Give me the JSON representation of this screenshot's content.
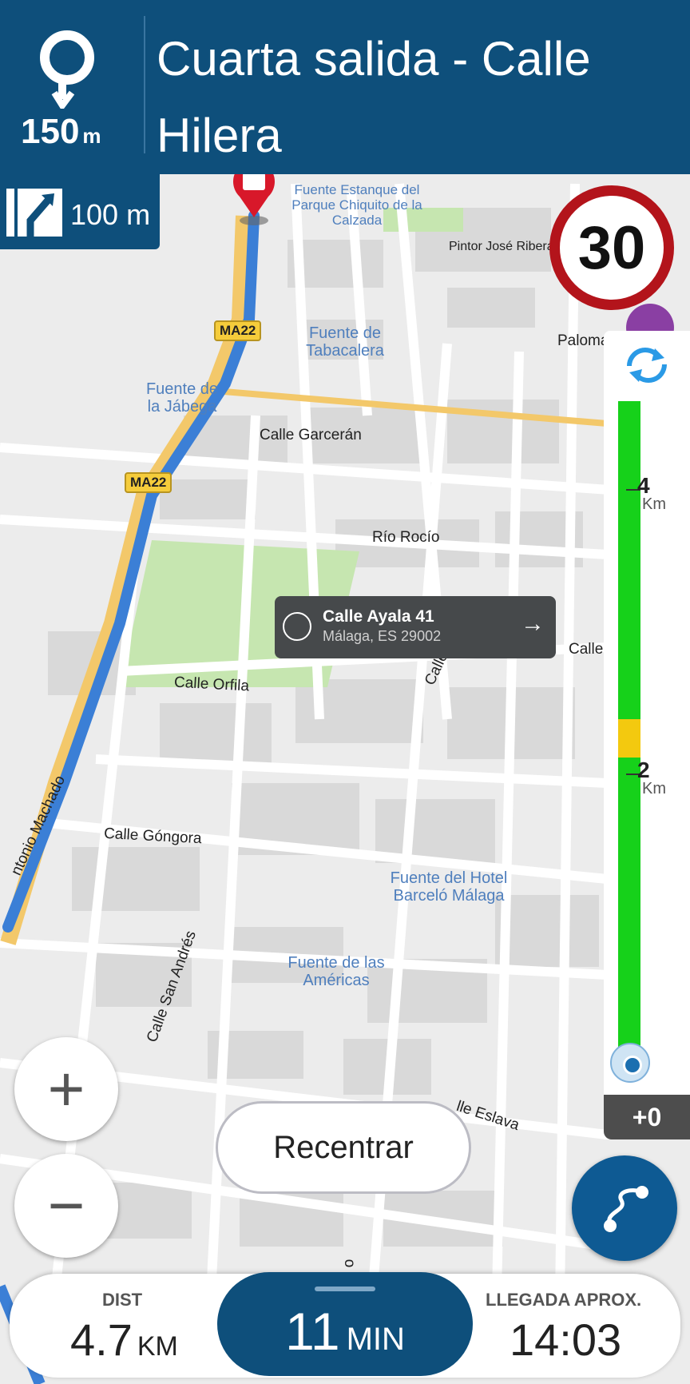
{
  "maneuver": {
    "distance_value": "150",
    "distance_unit": "m",
    "street": "Cuarta salida - Calle Hilera",
    "icon": "roundabout-exit-icon"
  },
  "lane": {
    "distance": "100 m",
    "icon": "lane-guidance-icon"
  },
  "speed_limit": "30",
  "map": {
    "streets": [
      "Calle Garcerán",
      "Río Rocío",
      "Calle Orfila",
      "Calle Góngora",
      "Calle San Andrés",
      "ntonio Machado",
      "Pintor José Ribera",
      "Paloma",
      "Calle",
      "Calle Ayala",
      "lle Eslava",
      "o"
    ],
    "pois": [
      "Fuente Estanque del Parque Chiquito de la Calzada",
      "Fuente de Tabacalera",
      "Fuente de la Jábega",
      "Fuente del Hotel Barceló Málaga",
      "Fuente de las Américas"
    ],
    "shields": [
      "MA22",
      "MA22"
    ]
  },
  "poi_card": {
    "title": "Calle Ayala 41",
    "subtitle": "Málaga, ES 29002"
  },
  "traffic": {
    "marks": [
      {
        "value": "4",
        "unit": "Km"
      },
      {
        "value": "2",
        "unit": "Km"
      }
    ],
    "delay": "+0",
    "colors": {
      "free": "#16d11a",
      "slow": "#f3c90f"
    }
  },
  "controls": {
    "zoom_in": "+",
    "zoom_out": "−",
    "recenter": "Recentrar"
  },
  "bottom": {
    "dist_label": "DIST",
    "dist_value": "4.7",
    "dist_unit": "KM",
    "time_value": "11",
    "time_unit": "MIN",
    "eta_label": "LLEGADA APROX.",
    "eta_value": "14:03"
  }
}
